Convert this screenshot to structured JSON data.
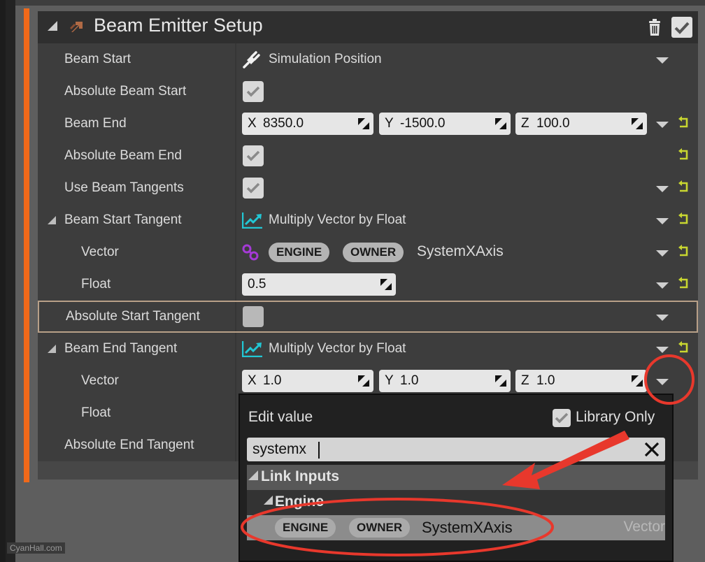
{
  "module": {
    "title": "Beam Emitter Setup",
    "emitter_icon": "emitter-arrow-icon",
    "delete_icon": "trash-icon",
    "enabled": true,
    "accent_color": "#f0691a"
  },
  "rows": [
    {
      "label": "Beam Start",
      "value_type": "dynamic",
      "value_icon": "plug-icon",
      "value": "Simulation Position",
      "has_dropdown": true,
      "has_reset": false
    },
    {
      "label": "Absolute Beam Start",
      "value_type": "checkbox",
      "checked": true,
      "has_dropdown": false,
      "has_reset": false
    },
    {
      "label": "Beam End",
      "value_type": "vector",
      "x": "8350.0",
      "y": "-1500.0",
      "z": "100.0",
      "has_dropdown": true,
      "has_reset": true
    },
    {
      "label": "Absolute Beam End",
      "value_type": "checkbox",
      "checked": true,
      "has_dropdown": false,
      "has_reset": true
    },
    {
      "label": "Use Beam Tangents",
      "value_type": "checkbox",
      "checked": true,
      "has_dropdown": true,
      "has_reset": true
    },
    {
      "label": "Beam Start Tangent",
      "expanded": true,
      "value_type": "dynamic",
      "value_icon": "graph-icon",
      "value": "Multiply Vector by Float",
      "has_dropdown": true,
      "has_reset": true
    },
    {
      "label": "Vector",
      "indent": true,
      "value_type": "link",
      "value_icon": "link-icon",
      "tags": [
        "ENGINE",
        "OWNER"
      ],
      "value": "SystemXAxis",
      "has_dropdown": true,
      "has_reset": true
    },
    {
      "label": "Float",
      "indent": true,
      "value_type": "float",
      "value": "0.5",
      "has_dropdown": true,
      "has_reset": true
    },
    {
      "label": "Absolute Start Tangent",
      "value_type": "checkbox",
      "checked": false,
      "selected": true,
      "has_dropdown": true,
      "has_reset": false
    },
    {
      "label": "Beam End Tangent",
      "expanded": true,
      "value_type": "dynamic",
      "value_icon": "graph-icon",
      "value": "Multiply Vector by Float",
      "has_dropdown": true,
      "has_reset": true
    },
    {
      "label": "Vector",
      "indent": true,
      "value_type": "vector",
      "x": "1.0",
      "y": "1.0",
      "z": "1.0",
      "has_dropdown": true,
      "has_reset": false
    },
    {
      "label": "Float",
      "indent": true
    },
    {
      "label": "Absolute End Tangent"
    }
  ],
  "vector_axes": [
    "X",
    "Y",
    "Z"
  ],
  "popup": {
    "title": "Edit value",
    "library_only_label": "Library Only",
    "library_only_checked": true,
    "search_value": "systemx",
    "search_placeholder": "",
    "category": "Link Inputs",
    "subcategory": "Engine",
    "result": {
      "tags": [
        "ENGINE",
        "OWNER"
      ],
      "name": "SystemXAxis",
      "type": "Vector"
    }
  },
  "colors": {
    "reset_arrow": "#c8d630",
    "graph_icon": "#22c7d4",
    "link_icon": "#a53ad6",
    "annotation_red": "#e8382c"
  },
  "watermark": "CyanHall.com"
}
